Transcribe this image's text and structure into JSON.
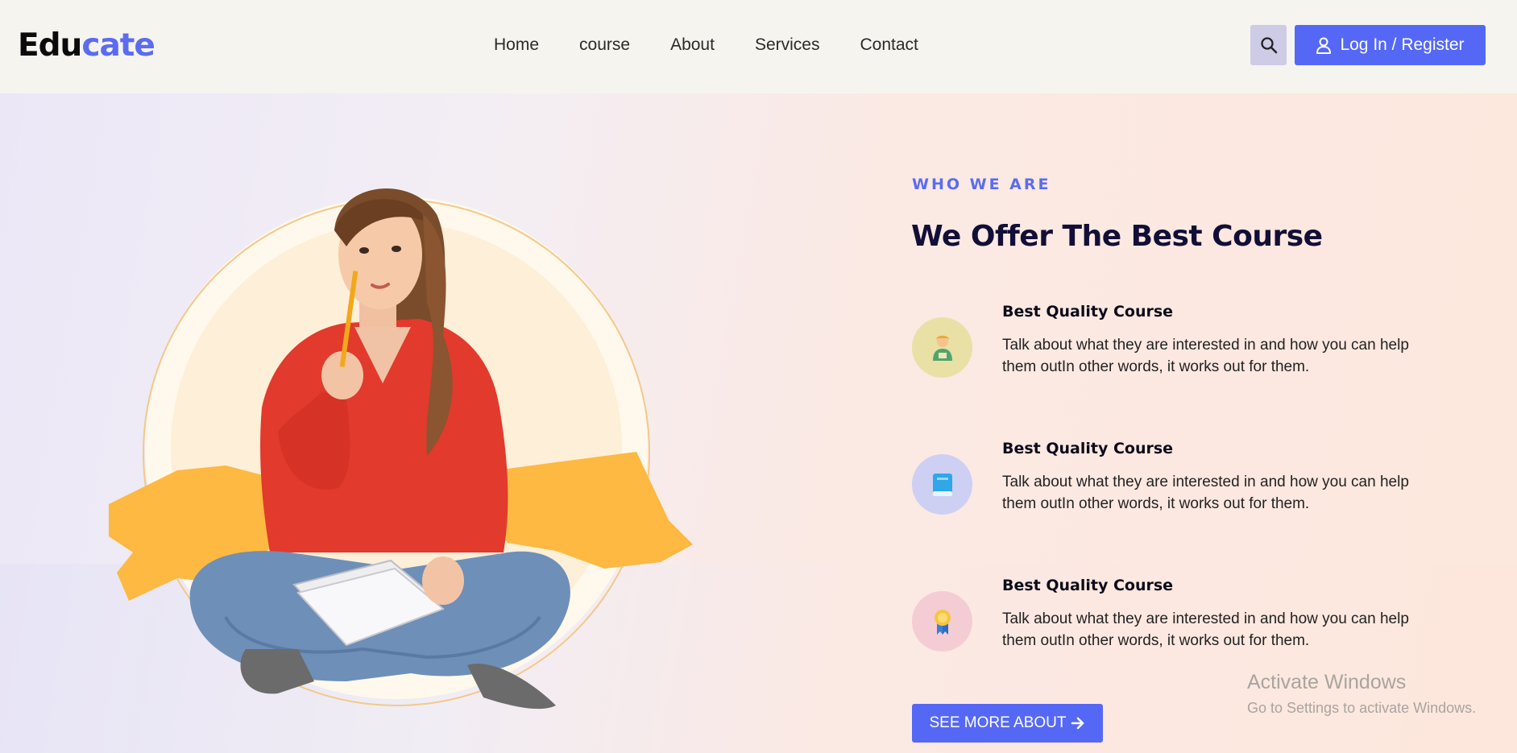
{
  "brand": {
    "logo_part1": "Edu",
    "logo_part2": "cate",
    "accent": "#5b6cf2"
  },
  "nav": {
    "items": [
      {
        "label": "Home"
      },
      {
        "label": "course"
      },
      {
        "label": "About"
      },
      {
        "label": "Services"
      },
      {
        "label": "Contact"
      }
    ]
  },
  "header": {
    "search_icon": "search-icon",
    "login_icon": "user-icon",
    "login_label": "Log In / Register"
  },
  "hero": {
    "eyebrow": "WHO WE ARE",
    "title": "We Offer The Best Course",
    "features": [
      {
        "icon": "student-icon",
        "icon_bg": "#e9e0a6",
        "title": "Best Quality Course",
        "description": "Talk about what they are interested in and how you can help them outIn other words, it works out for them."
      },
      {
        "icon": "book-icon",
        "icon_bg": "#cdd0f3",
        "title": "Best Quality Course",
        "description": "Talk about what they are interested in and how you can help them outIn other words, it works out for them."
      },
      {
        "icon": "award-icon",
        "icon_bg": "#f3cdd3",
        "title": "Best Quality Course",
        "description": "Talk about what they are interested in and how you can help them outIn other words, it works out for them."
      }
    ],
    "cta_label": "SEE MORE ABOUT",
    "cta_icon": "arrow-right-icon"
  },
  "watermark": {
    "line1": "Activate Windows",
    "line2": "Go to Settings to activate Windows."
  }
}
